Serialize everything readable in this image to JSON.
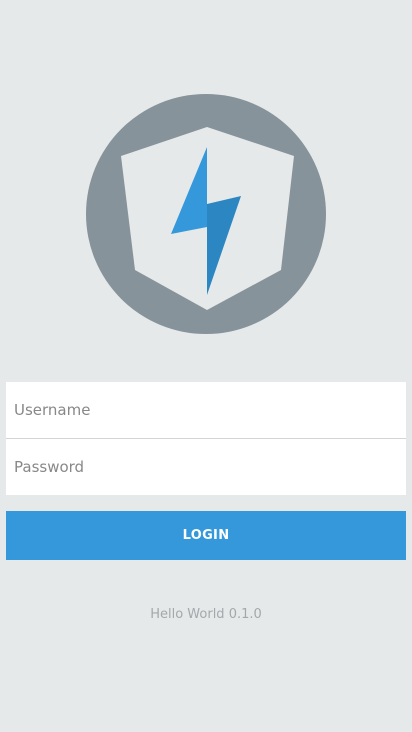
{
  "logo": {
    "icon": "lightning-shield-icon",
    "circle_color": "#87939a",
    "shield_color": "#e6e9ea",
    "bolt_light_color": "#3498db",
    "bolt_dark_color": "#2c86c2"
  },
  "form": {
    "username_placeholder": "Username",
    "password_placeholder": "Password"
  },
  "login_button": {
    "label": "LOGIN",
    "color": "#3498db"
  },
  "footer": {
    "version_text": "Hello World 0.1.0"
  }
}
